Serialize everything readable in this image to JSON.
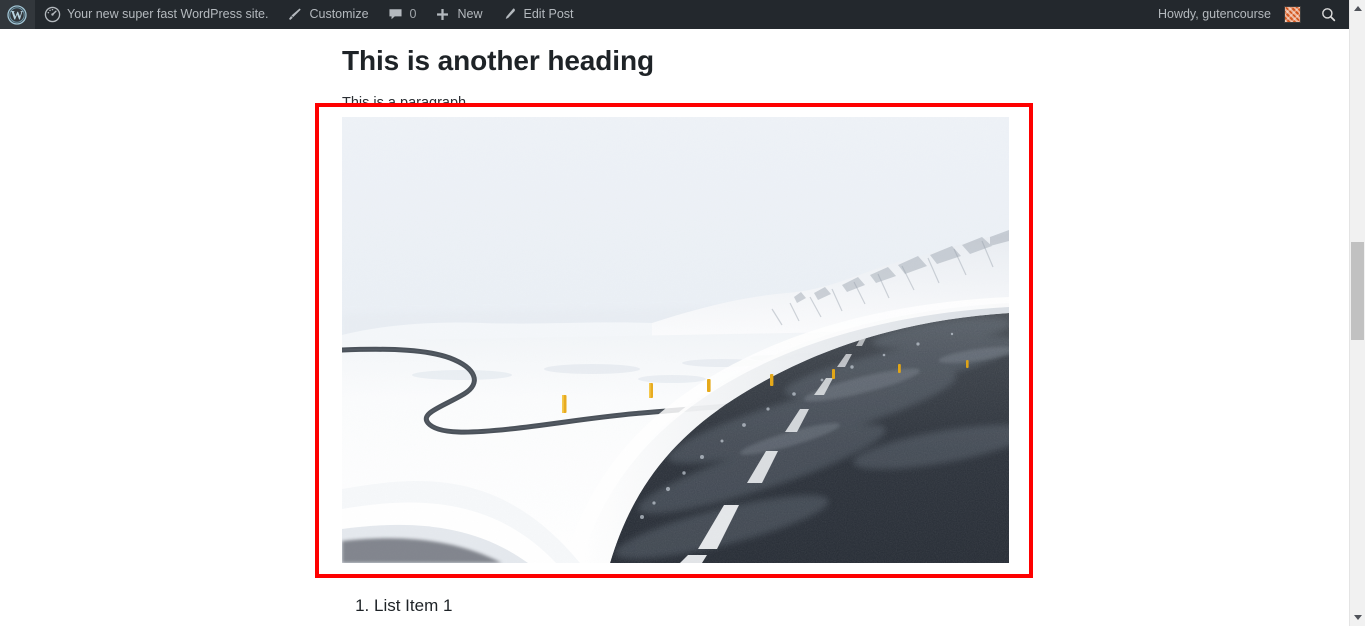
{
  "adminbar": {
    "logo_icon": "wordpress-logo-icon",
    "site": {
      "icon": "dashboard-speedometer-icon",
      "label": "Your new super fast WordPress site."
    },
    "customize": {
      "icon": "paintbrush-icon",
      "label": "Customize"
    },
    "comments": {
      "icon": "comment-bubble-icon",
      "count": "0"
    },
    "new": {
      "icon": "plus-icon",
      "label": "New"
    },
    "edit_post": {
      "icon": "pencil-icon",
      "label": "Edit Post"
    },
    "account": {
      "greeting": "Howdy, gutencourse",
      "avatar_icon": "gravatar-identicon",
      "avatar_color": "#d4581f"
    },
    "search": {
      "icon": "search-icon"
    },
    "background_color": "#23282d",
    "text_color": "#b4b9be"
  },
  "page": {
    "heading": "This is another heading",
    "paragraph": "This is a paragraph",
    "list": {
      "items": [
        "List Item 1"
      ]
    }
  },
  "image_block": {
    "selected": true,
    "selection_color": "#fe0000",
    "alt": "Snow-covered landscape with a winding dark asphalt road and yellow roadside marker posts, snowy mountains on the horizon",
    "width": "667",
    "height": "446"
  },
  "scrollbar": {
    "up_arrow_icon": "triangle-up-icon",
    "down_arrow_icon": "triangle-down-icon",
    "track_color": "#f1f1f1",
    "thumb_color": "#c1c1c1"
  }
}
